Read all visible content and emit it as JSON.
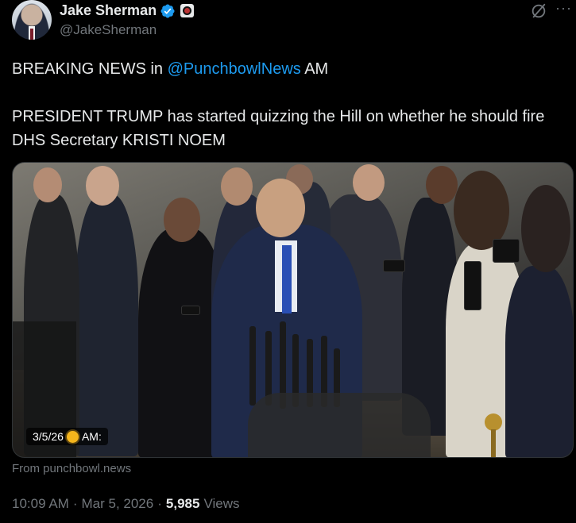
{
  "author": {
    "display_name": "Jake Sherman",
    "handle": "@JakeSherman",
    "verified_icon": "verified-badge-icon",
    "affiliation_icon": "affiliate-logo-icon"
  },
  "actions": {
    "grok_icon": "grok-icon",
    "more_label": "···"
  },
  "tweet": {
    "line1_prefix": "BREAKING NEWS in ",
    "line1_mention": "@PunchbowlNews",
    "line1_suffix": " AM",
    "paragraph2": "PRESIDENT TRUMP has started quizzing the Hill on whether he should fire DHS Secretary KRISTI NOEM"
  },
  "media": {
    "timestamp_date": "3/5/26",
    "timestamp_suffix": "AM:"
  },
  "source": "From punchbowl.news",
  "meta": {
    "time": "10:09 AM",
    "separator": "·",
    "date": "Mar 5, 2026",
    "separator2": "·",
    "views_count": "5,985",
    "views_label": "Views"
  },
  "colors": {
    "background": "#000000",
    "text": "#e7e9ea",
    "secondary": "#71767b",
    "accent": "#1d9bf0"
  }
}
